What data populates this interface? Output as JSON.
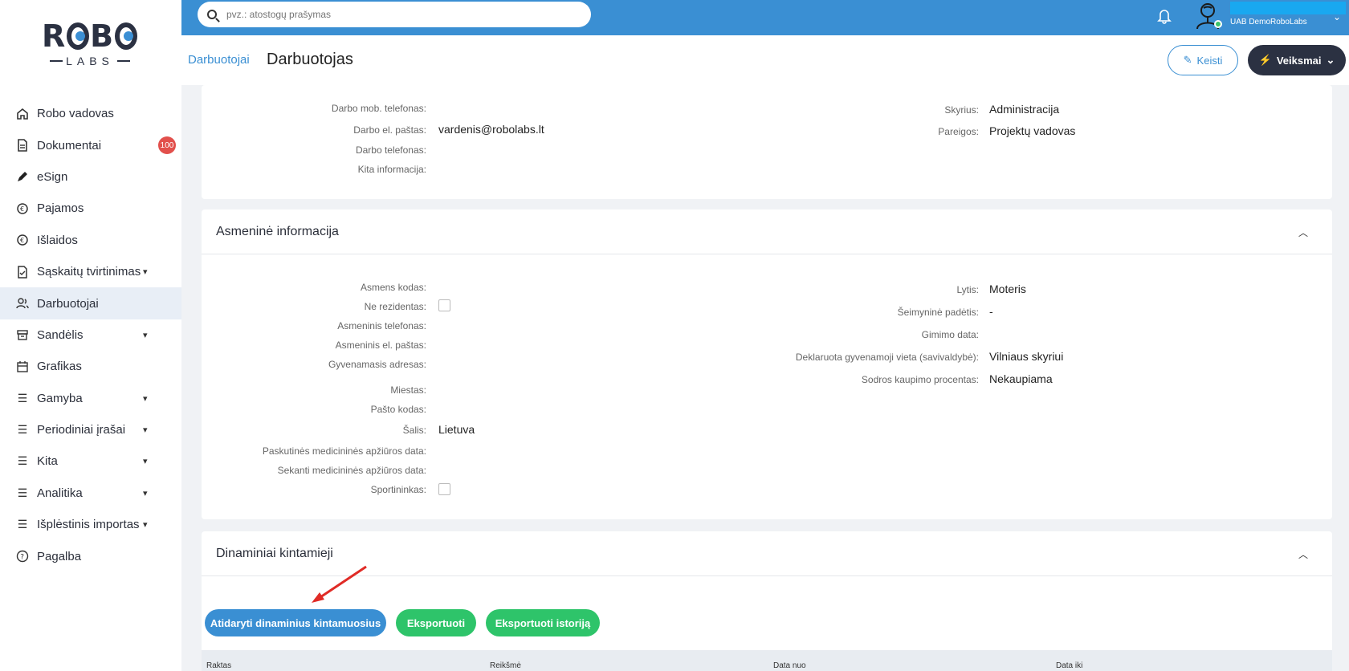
{
  "sidebar": {
    "logo_top": "ROBO",
    "logo_bottom": "LABS",
    "items": [
      {
        "label": "Robo vadovas",
        "icon": "home-icon",
        "chevron": false
      },
      {
        "label": "Dokumentai",
        "icon": "document-icon",
        "chevron": false,
        "badge": "100"
      },
      {
        "label": "eSign",
        "icon": "pen-icon",
        "chevron": false
      },
      {
        "label": "Pajamos",
        "icon": "income-icon",
        "chevron": false
      },
      {
        "label": "Išlaidos",
        "icon": "expense-icon",
        "chevron": false
      },
      {
        "label": "Sąskaitų tvirtinimas",
        "icon": "invoice-check-icon",
        "chevron": true
      },
      {
        "label": "Darbuotojai",
        "icon": "users-icon",
        "chevron": false,
        "active": true
      },
      {
        "label": "Sandėlis",
        "icon": "warehouse-icon",
        "chevron": true
      },
      {
        "label": "Grafikas",
        "icon": "calendar-icon",
        "chevron": false
      },
      {
        "label": "Gamyba",
        "icon": "list-icon",
        "chevron": true
      },
      {
        "label": "Periodiniai įrašai",
        "icon": "list-icon",
        "chevron": true
      },
      {
        "label": "Kita",
        "icon": "list-icon",
        "chevron": true
      },
      {
        "label": "Analitika",
        "icon": "list-icon",
        "chevron": true
      },
      {
        "label": "Išplėstinis importas",
        "icon": "list-icon",
        "chevron": true
      },
      {
        "label": "Pagalba",
        "icon": "help-icon",
        "chevron": false
      }
    ]
  },
  "topbar": {
    "search_placeholder": "pvz.: atostogų prašymas",
    "company": "UAB DemoRoboLabs"
  },
  "header": {
    "breadcrumb": "Darbuotojai",
    "title": "Darbuotojas",
    "edit_label": "Keisti",
    "actions_label": "Veiksmai"
  },
  "work_info": {
    "left": [
      {
        "label": "Darbo mob. telefonas:",
        "value": ""
      },
      {
        "label": "Darbo el. paštas:",
        "value": "vardenis@robolabs.lt"
      },
      {
        "label": "Darbo telefonas:",
        "value": ""
      },
      {
        "label": "Kita informacija:",
        "value": ""
      }
    ],
    "right": [
      {
        "label": "Skyrius:",
        "value": "Administracija"
      },
      {
        "label": "Pareigos:",
        "value": "Projektų vadovas"
      }
    ]
  },
  "personal": {
    "title": "Asmeninė informacija",
    "left": [
      {
        "label": "Asmens kodas:",
        "value": ""
      },
      {
        "label": "Ne rezidentas:",
        "checkbox": true
      },
      {
        "label": "Asmeninis telefonas:",
        "value": ""
      },
      {
        "label": "Asmeninis el. paštas:",
        "value": ""
      },
      {
        "label": "Gyvenamasis adresas:",
        "value": ""
      },
      {
        "label": "Miestas:",
        "value": ""
      },
      {
        "label": "Pašto kodas:",
        "value": ""
      },
      {
        "label": "Šalis:",
        "value": "Lietuva"
      },
      {
        "label": "Paskutinės medicininės apžiūros data:",
        "value": ""
      },
      {
        "label": "Sekanti medicininės apžiūros data:",
        "value": ""
      },
      {
        "label": "Sportininkas:",
        "checkbox": true
      }
    ],
    "right": [
      {
        "label": "Lytis:",
        "value": "Moteris"
      },
      {
        "label": "Šeimyninė padėtis:",
        "value": "-"
      },
      {
        "label": "Gimimo data:",
        "value": ""
      },
      {
        "label": "Deklaruota gyvenamoji vieta (savivaldybė):",
        "value": "Vilniaus skyriui"
      },
      {
        "label": "Sodros kaupimo procentas:",
        "value": "Nekaupiama"
      }
    ]
  },
  "dynamic": {
    "title": "Dinaminiai kintamieji",
    "btn_open": "Atidaryti dinaminius kintamuosius",
    "btn_export": "Eksportuoti",
    "btn_export_history": "Eksportuoti istoriją",
    "columns": [
      "Raktas",
      "Reikšmė",
      "Data nuo",
      "Data iki"
    ]
  },
  "colors": {
    "primary": "#3a8fd3",
    "success": "#2ec46a",
    "dark": "#2b3142",
    "badge": "#e2504c"
  }
}
